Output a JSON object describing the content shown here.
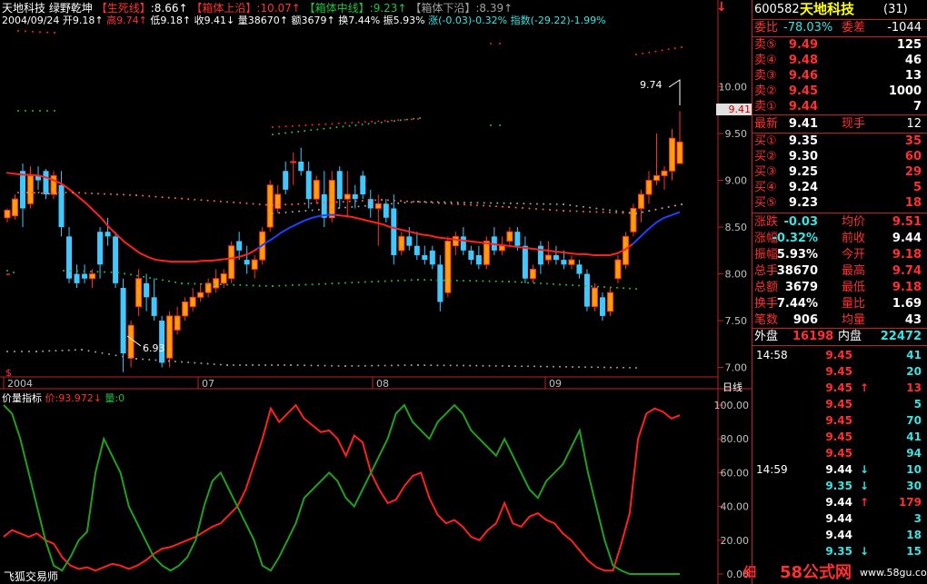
{
  "header": {
    "name": "天地科技",
    "indicator": "绿野乾坤",
    "sl_label": "【生死线】",
    "sl_value": ":8.66↑",
    "top_label": "【箱体上沿】",
    "top_value": ":10.07↑",
    "mid_label": "【箱体中线】",
    "mid_value": ":9.23↑",
    "bot_label": "【箱体下沿】",
    "bot_value": ":8.39↑",
    "date": "2004/09/24",
    "open_label": "开",
    "open": "9.18↑",
    "high_label": "高",
    "high": "9.74↑",
    "low_label": "低",
    "low": "9.18↑",
    "close_label": "收",
    "close": "9.41↓",
    "vol_label": "量",
    "vol": "38670↑",
    "amt_label": "额",
    "amt": "3679↑",
    "turn_label": "换",
    "turn": "7.44%",
    "amp_label": "振",
    "amp": "5.93%",
    "chg_label": "涨",
    "chg": "(-0.03)-0.32%",
    "idx_label": "指数",
    "idx": "(-29.22)-1.99%"
  },
  "top_arrow": "↓",
  "price_axis": [
    "10.00",
    "9.50",
    "9.00",
    "8.50",
    "8.00",
    "7.50",
    "7.00"
  ],
  "current_price_tag": "9.41",
  "x_labels": [
    "2004",
    "07",
    "08",
    "09"
  ],
  "period_label": "日线",
  "dollar_mark": "$",
  "high_annot": "9.74",
  "low_annot": "6.93",
  "sub": {
    "title": "价量指标",
    "price_label": "价:93.972↓",
    "vol_label": "量:0",
    "axis": [
      "100.00",
      "80.00",
      "60.00",
      "40.00",
      "20.00",
      "0.00"
    ]
  },
  "watermark_left": "飞狐交易师",
  "watermark_right": "58公式网",
  "watermark_url": "www.58gu.com",
  "watermark_small": "细",
  "panel": {
    "code": "600582",
    "name": "天地科技",
    "num": "(31)",
    "wb_label": "委比",
    "wb": "-78.03%",
    "wc_label": "委差",
    "wc": "-1044",
    "sells": [
      {
        "label": "卖⑤",
        "price": "9.49",
        "vol": "125"
      },
      {
        "label": "卖④",
        "price": "9.48",
        "vol": "46"
      },
      {
        "label": "卖③",
        "price": "9.46",
        "vol": "13"
      },
      {
        "label": "卖②",
        "price": "9.45",
        "vol": "1000"
      },
      {
        "label": "卖①",
        "price": "9.44",
        "vol": "7"
      }
    ],
    "latest_label": "最新",
    "latest": "9.41",
    "hand_label": "现手",
    "hand": "12",
    "buys": [
      {
        "label": "买①",
        "price": "9.35",
        "vol": "35"
      },
      {
        "label": "买②",
        "price": "9.30",
        "vol": "60"
      },
      {
        "label": "买③",
        "price": "9.25",
        "vol": "29"
      },
      {
        "label": "买④",
        "price": "9.24",
        "vol": "5"
      },
      {
        "label": "买⑤",
        "price": "9.23",
        "vol": "18"
      }
    ],
    "stats": [
      {
        "l1": "涨跌",
        "v1": "-0.03",
        "l2": "均价",
        "v2": "9.51"
      },
      {
        "l1": "涨幅",
        "v1": "-0.32%",
        "l2": "前收",
        "v2": "9.44"
      },
      {
        "l1": "振幅",
        "v1": "5.93%",
        "l2": "今开",
        "v2": "9.18"
      },
      {
        "l1": "总手",
        "v1": "38670",
        "l2": "最高",
        "v2": "9.74"
      },
      {
        "l1": "总额",
        "v1": "3679",
        "l2": "最低",
        "v2": "9.18"
      },
      {
        "l1": "换手",
        "v1": "7.44%",
        "l2": "量比",
        "v2": "1.69"
      },
      {
        "l1": "笔数",
        "v1": "906",
        "l2": "均量",
        "v2": "43"
      }
    ],
    "outer_label": "外盘",
    "outer": "16198",
    "inner_label": "内盘",
    "inner": "22472",
    "ticks": [
      {
        "time": "14:58",
        "price": "9.45",
        "arrow": "",
        "vol": "41"
      },
      {
        "time": "",
        "price": "9.45",
        "arrow": "",
        "vol": "20"
      },
      {
        "time": "",
        "price": "9.45",
        "arrow": "↑",
        "vol": "13"
      },
      {
        "time": "",
        "price": "9.45",
        "arrow": "",
        "vol": "5"
      },
      {
        "time": "",
        "price": "9.45",
        "arrow": "",
        "vol": "70"
      },
      {
        "time": "",
        "price": "9.45",
        "arrow": "",
        "vol": "41"
      },
      {
        "time": "",
        "price": "9.45",
        "arrow": "",
        "vol": "94"
      },
      {
        "time": "14:59",
        "price": "9.44",
        "arrow": "↓",
        "vol": "10"
      },
      {
        "time": "",
        "price": "9.35",
        "arrow": "↓",
        "vol": "30"
      },
      {
        "time": "",
        "price": "9.44",
        "arrow": "↑",
        "vol": "179"
      },
      {
        "time": "",
        "price": "9.44",
        "arrow": "",
        "vol": "3"
      },
      {
        "time": "",
        "price": "9.44",
        "arrow": "",
        "vol": "18"
      },
      {
        "time": "",
        "price": "9.35",
        "arrow": "↓",
        "vol": "15"
      }
    ]
  },
  "colors": {
    "up": "#ff3030",
    "down": "#40c8ff",
    "bg": "#000000",
    "grid": "#800000"
  },
  "chart_data": {
    "type": "candlestick",
    "y_range": [
      6.85,
      10.15
    ],
    "candles": [
      [
        8.6,
        8.7,
        8.55,
        8.68
      ],
      [
        8.62,
        8.85,
        8.58,
        8.8
      ],
      [
        9.1,
        9.18,
        8.5,
        8.7
      ],
      [
        8.75,
        9.15,
        8.7,
        9.05
      ],
      [
        9.05,
        9.15,
        8.9,
        9.0
      ],
      [
        9.1,
        9.12,
        8.8,
        8.85
      ],
      [
        8.85,
        9.1,
        8.8,
        9.05
      ],
      [
        8.95,
        9.1,
        8.4,
        8.5
      ],
      [
        8.4,
        8.5,
        7.9,
        7.95
      ],
      [
        8.0,
        8.1,
        7.85,
        7.9
      ],
      [
        8.0,
        8.1,
        7.9,
        7.95
      ],
      [
        7.95,
        8.05,
        7.85,
        8.0
      ],
      [
        8.45,
        8.5,
        7.95,
        8.1
      ],
      [
        8.45,
        8.6,
        8.3,
        8.4
      ],
      [
        8.4,
        8.45,
        7.85,
        7.9
      ],
      [
        7.85,
        7.95,
        6.95,
        7.15
      ],
      [
        7.1,
        7.5,
        7.0,
        7.45
      ],
      [
        7.65,
        8.05,
        7.55,
        7.95
      ],
      [
        7.9,
        8.0,
        7.6,
        7.75
      ],
      [
        7.75,
        7.95,
        7.5,
        7.55
      ],
      [
        7.5,
        7.55,
        7.0,
        7.05
      ],
      [
        7.1,
        7.6,
        7.0,
        7.55
      ],
      [
        7.4,
        7.65,
        7.35,
        7.55
      ],
      [
        7.55,
        7.75,
        7.5,
        7.7
      ],
      [
        7.65,
        7.85,
        7.6,
        7.75
      ],
      [
        7.75,
        7.9,
        7.7,
        7.8
      ],
      [
        7.8,
        7.95,
        7.75,
        7.9
      ],
      [
        7.85,
        8.05,
        7.8,
        7.95
      ],
      [
        7.9,
        8.05,
        7.85,
        8.0
      ],
      [
        7.95,
        8.35,
        7.9,
        8.3
      ],
      [
        8.35,
        8.45,
        8.15,
        8.25
      ],
      [
        8.15,
        8.3,
        8.0,
        8.1
      ],
      [
        8.05,
        8.2,
        7.95,
        8.15
      ],
      [
        8.15,
        8.5,
        8.1,
        8.45
      ],
      [
        8.5,
        9.0,
        8.45,
        8.95
      ],
      [
        8.7,
        8.95,
        8.65,
        8.85
      ],
      [
        9.1,
        9.2,
        8.85,
        8.9
      ],
      [
        9.2,
        9.3,
        8.95,
        9.2
      ],
      [
        9.2,
        9.35,
        9.05,
        9.1
      ],
      [
        9.1,
        9.2,
        8.7,
        8.8
      ],
      [
        8.8,
        9.05,
        8.75,
        9.0
      ],
      [
        8.85,
        9.1,
        8.5,
        8.6
      ],
      [
        8.6,
        9.1,
        8.55,
        9.0
      ],
      [
        9.1,
        9.15,
        8.7,
        8.8
      ],
      [
        8.8,
        9.1,
        8.6,
        8.85
      ],
      [
        8.85,
        8.95,
        8.7,
        8.8
      ],
      [
        9.05,
        9.1,
        8.8,
        8.85
      ],
      [
        8.8,
        8.9,
        8.6,
        8.7
      ],
      [
        8.7,
        8.85,
        8.3,
        8.75
      ],
      [
        8.75,
        8.8,
        8.55,
        8.6
      ],
      [
        8.7,
        8.85,
        8.1,
        8.2
      ],
      [
        8.25,
        8.45,
        8.2,
        8.4
      ],
      [
        8.4,
        8.5,
        8.25,
        8.3
      ],
      [
        8.3,
        8.45,
        8.15,
        8.2
      ],
      [
        8.2,
        8.3,
        8.1,
        8.15
      ],
      [
        8.25,
        8.3,
        8.05,
        8.1
      ],
      [
        8.1,
        8.2,
        7.6,
        7.7
      ],
      [
        7.8,
        8.4,
        7.75,
        8.35
      ],
      [
        8.3,
        8.45,
        8.2,
        8.4
      ],
      [
        8.4,
        8.5,
        8.2,
        8.25
      ],
      [
        8.25,
        8.3,
        8.1,
        8.15
      ],
      [
        8.2,
        8.3,
        8.05,
        8.1
      ],
      [
        8.1,
        8.4,
        8.05,
        8.35
      ],
      [
        8.4,
        8.5,
        8.2,
        8.25
      ],
      [
        8.25,
        8.4,
        8.2,
        8.3
      ],
      [
        8.35,
        8.5,
        8.3,
        8.45
      ],
      [
        8.45,
        8.5,
        8.25,
        8.3
      ],
      [
        8.3,
        8.4,
        7.9,
        7.95
      ],
      [
        7.95,
        8.1,
        7.9,
        8.05
      ],
      [
        8.3,
        8.35,
        8.0,
        8.1
      ],
      [
        8.15,
        8.35,
        8.1,
        8.2
      ],
      [
        8.2,
        8.3,
        8.1,
        8.15
      ],
      [
        8.15,
        8.25,
        8.05,
        8.1
      ],
      [
        8.1,
        8.2,
        8.05,
        8.15
      ],
      [
        8.1,
        8.15,
        7.95,
        8.0
      ],
      [
        8.0,
        8.05,
        7.6,
        7.65
      ],
      [
        7.65,
        7.9,
        7.6,
        7.85
      ],
      [
        7.75,
        7.8,
        7.5,
        7.55
      ],
      [
        7.6,
        7.85,
        7.55,
        7.8
      ],
      [
        7.95,
        8.2,
        7.9,
        8.15
      ],
      [
        8.1,
        8.45,
        8.05,
        8.4
      ],
      [
        8.45,
        8.75,
        8.4,
        8.7
      ],
      [
        8.7,
        8.9,
        8.55,
        8.85
      ],
      [
        8.85,
        9.1,
        8.75,
        9.0
      ],
      [
        9.0,
        9.5,
        8.95,
        9.05
      ],
      [
        9.05,
        9.15,
        8.9,
        9.1
      ],
      [
        9.1,
        9.55,
        9.0,
        9.45
      ],
      [
        9.18,
        9.74,
        9.18,
        9.41
      ]
    ],
    "series": [
      {
        "name": "生死线",
        "values": [
          9.08,
          9.07,
          9.06,
          9.06,
          9.05,
          9.03,
          9.0,
          8.96,
          8.9,
          8.83,
          8.76,
          8.68,
          8.6,
          8.5,
          8.42,
          8.34,
          8.28,
          8.22,
          8.18,
          8.15,
          8.14,
          8.13,
          8.13,
          8.13,
          8.13,
          8.14,
          8.14,
          8.15,
          8.16,
          8.17,
          8.19,
          8.22,
          8.27,
          8.33,
          8.38,
          8.44,
          8.49,
          8.53,
          8.57,
          8.6,
          8.62,
          8.63,
          8.63,
          8.62,
          8.61,
          8.59,
          8.57,
          8.55,
          8.53,
          8.5,
          8.48,
          8.46,
          8.44,
          8.42,
          8.41,
          8.39,
          8.38,
          8.37,
          8.36,
          8.35,
          8.34,
          8.33,
          8.32,
          8.31,
          8.3,
          8.29,
          8.28,
          8.27,
          8.26,
          8.25,
          8.24,
          8.23,
          8.22,
          8.21,
          8.21,
          8.2,
          8.2,
          8.2,
          8.22,
          8.26,
          8.32,
          8.4,
          8.48,
          8.55,
          8.6,
          8.63,
          8.66
        ]
      }
    ],
    "sub_series": [
      {
        "name": "价",
        "values": [
          22,
          26,
          24,
          22,
          24,
          20,
          18,
          10,
          5,
          3,
          4,
          2,
          4,
          6,
          5,
          3,
          5,
          8,
          12,
          15,
          16,
          18,
          20,
          22,
          25,
          28,
          30,
          35,
          40,
          50,
          65,
          80,
          98,
          90,
          95,
          100,
          92,
          88,
          84,
          85,
          80,
          70,
          82,
          78,
          60,
          50,
          42,
          44,
          52,
          58,
          60,
          45,
          35,
          30,
          32,
          28,
          22,
          20,
          26,
          30,
          42,
          30,
          28,
          34,
          36,
          32,
          30,
          24,
          20,
          14,
          8,
          4,
          2,
          2,
          18,
          36,
          80,
          95,
          98,
          96,
          92,
          93.972
        ]
      },
      {
        "name": "量",
        "values": [
          100,
          95,
          80,
          60,
          40,
          20,
          5,
          2,
          10,
          20,
          25,
          60,
          80,
          70,
          60,
          40,
          30,
          20,
          10,
          5,
          2,
          5,
          10,
          20,
          40,
          55,
          60,
          50,
          40,
          30,
          20,
          5,
          2,
          10,
          20,
          30,
          45,
          50,
          55,
          60,
          55,
          45,
          40,
          50,
          60,
          70,
          80,
          95,
          100,
          90,
          85,
          80,
          90,
          95,
          100,
          95,
          85,
          80,
          75,
          70,
          80,
          70,
          60,
          50,
          45,
          55,
          60,
          65,
          75,
          85,
          60,
          40,
          20,
          5,
          2,
          0,
          0,
          0,
          0,
          0,
          0,
          0
        ]
      }
    ],
    "sub_y_range": [
      0,
      100
    ]
  }
}
